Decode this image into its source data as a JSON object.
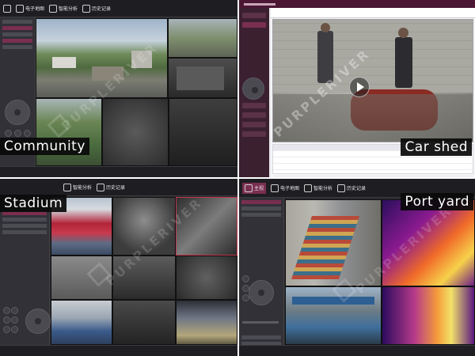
{
  "labels": {
    "community": "Community",
    "car_shed": "Car shed",
    "stadium": "Stadium",
    "port_yard": "Port yard"
  },
  "watermark": "PURPLERIVER",
  "toolbar": {
    "e_map": "电子地图",
    "smart_analysis": "智能分析",
    "history": "历史记录",
    "main_view": "主视",
    "e_map_short": "电子地图"
  },
  "colors": {
    "accent": "#7a2f50",
    "app_bg": "#2a2a2f",
    "title_bar": "#4b1734"
  }
}
